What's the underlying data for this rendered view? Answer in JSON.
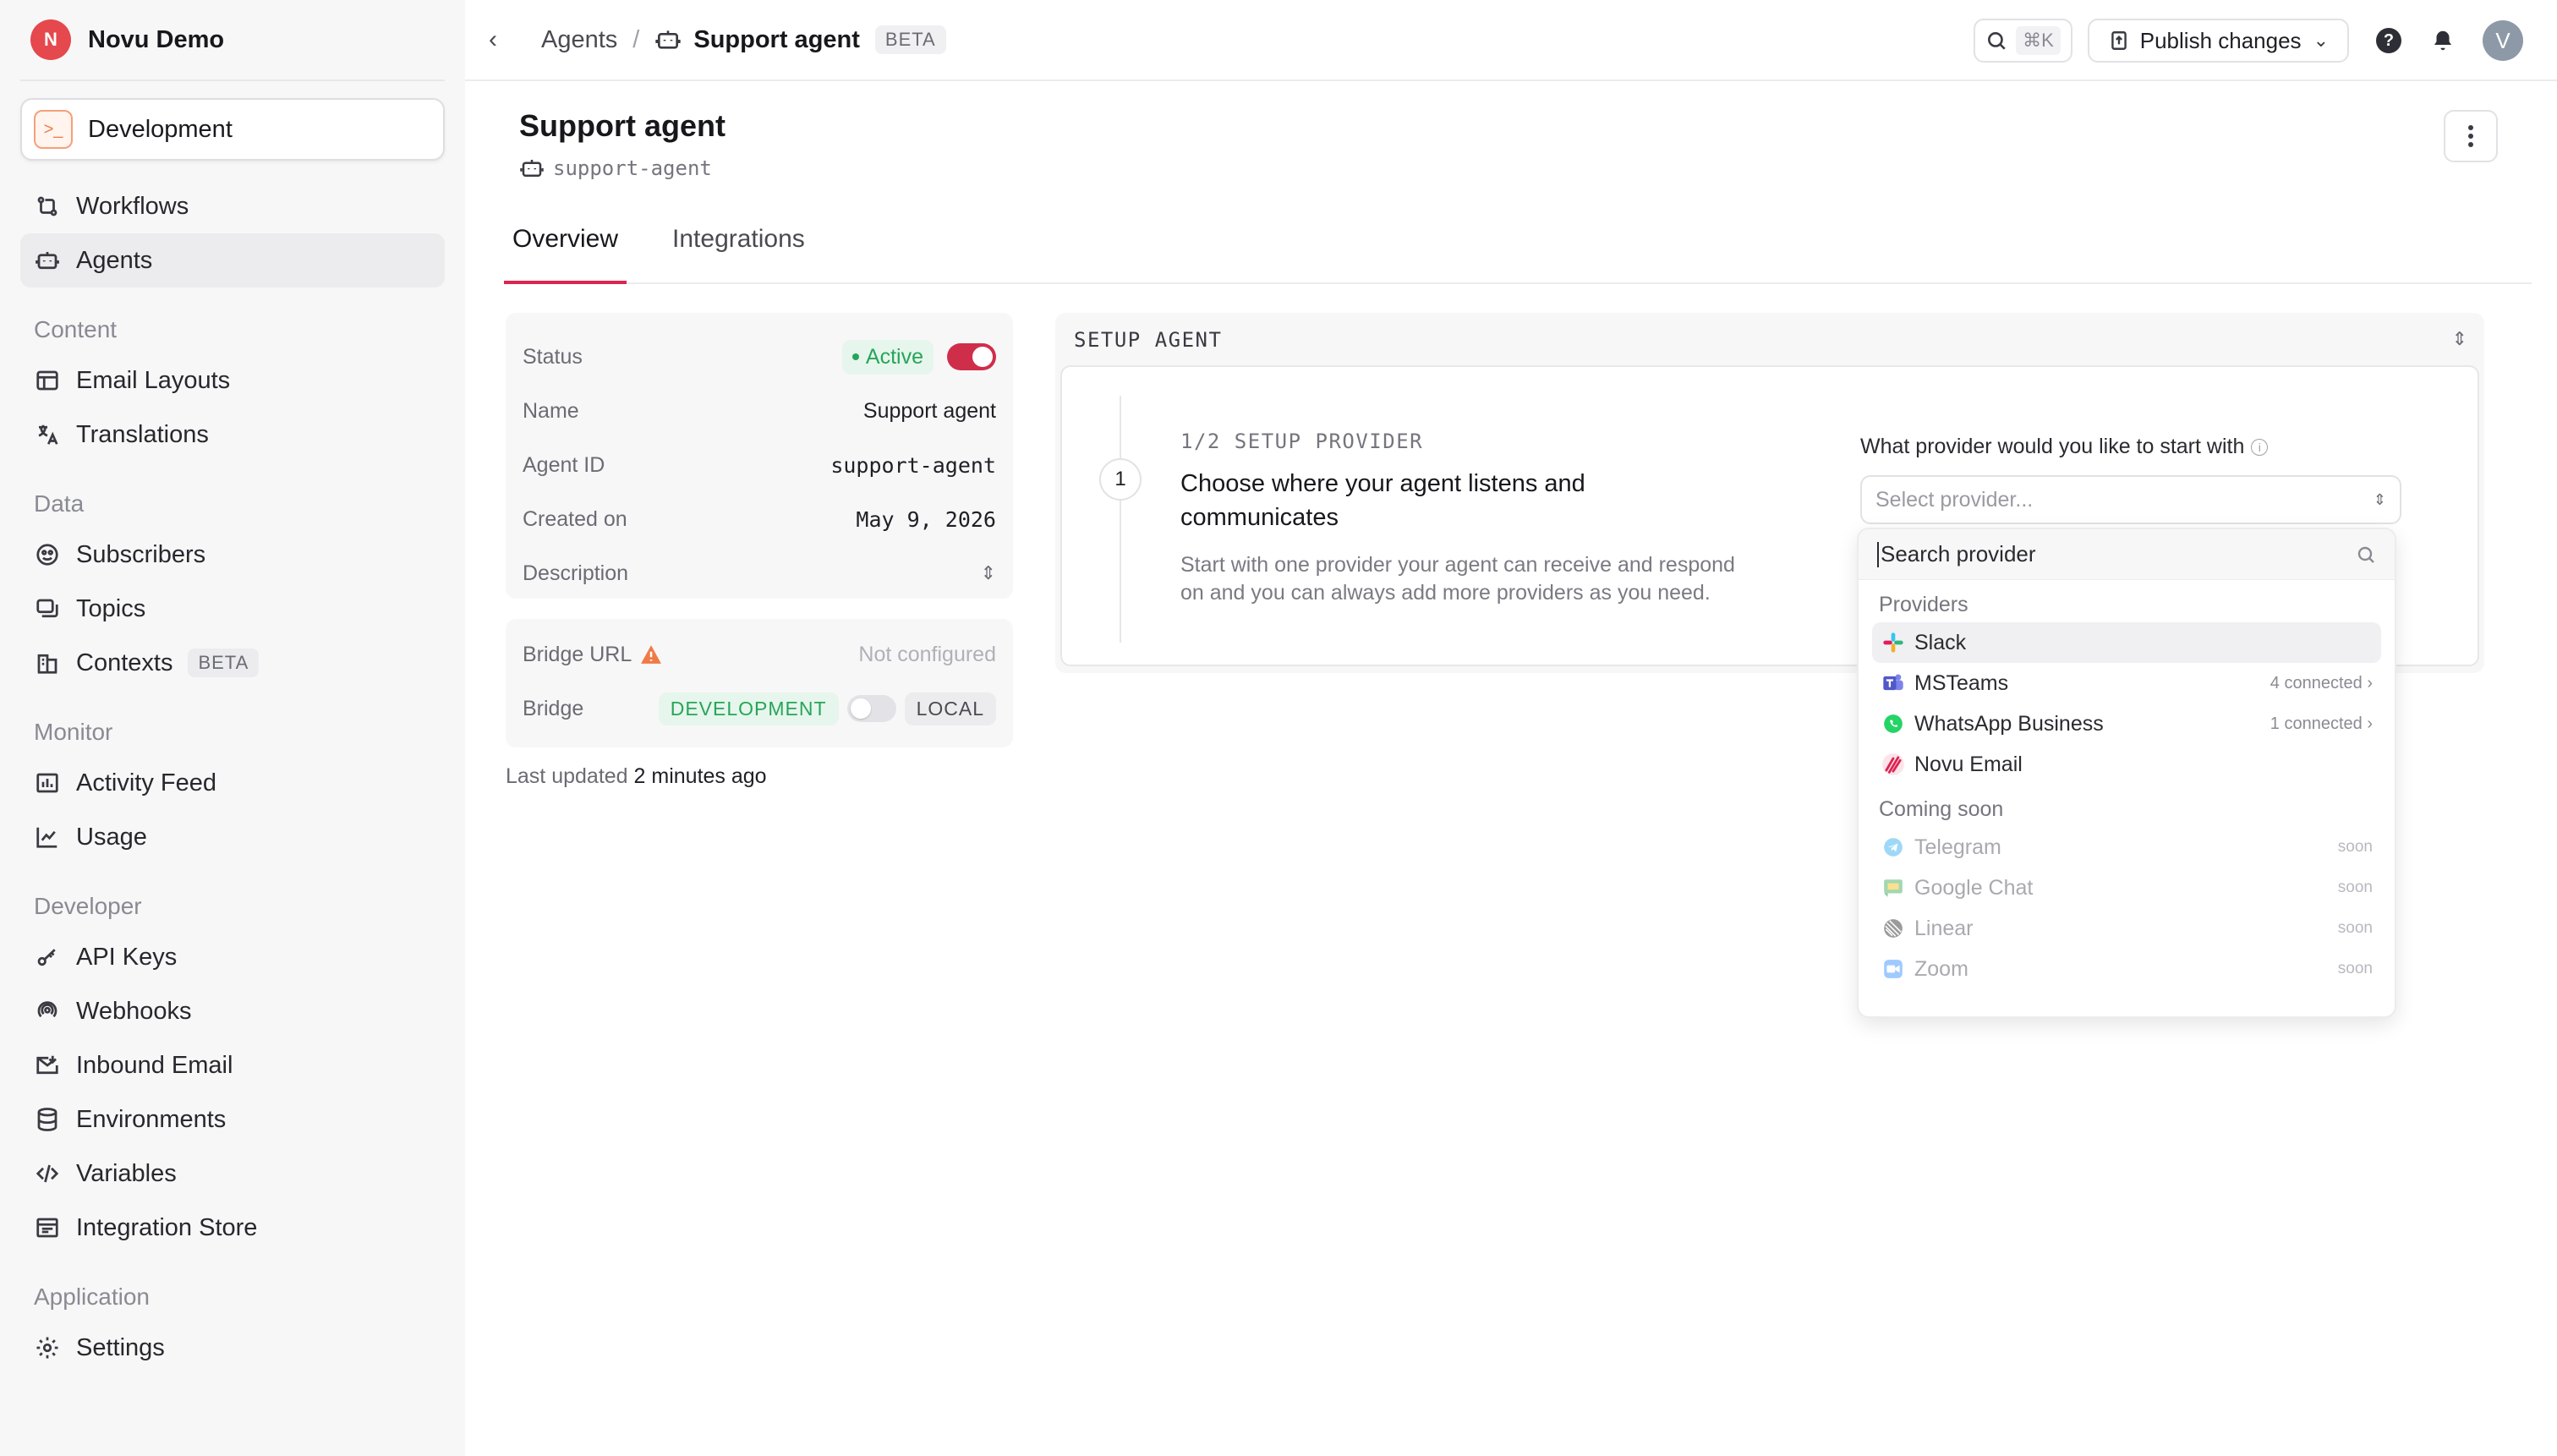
{
  "org": {
    "initial": "N",
    "name": "Novu Demo"
  },
  "environment": {
    "label": "Development"
  },
  "nav": {
    "main": [
      {
        "label": "Workflows"
      },
      {
        "label": "Agents"
      }
    ],
    "content_title": "Content",
    "content": [
      {
        "label": "Email Layouts"
      },
      {
        "label": "Translations"
      }
    ],
    "data_title": "Data",
    "data": [
      {
        "label": "Subscribers"
      },
      {
        "label": "Topics"
      },
      {
        "label": "Contexts",
        "badge": "BETA"
      }
    ],
    "monitor_title": "Monitor",
    "monitor": [
      {
        "label": "Activity Feed"
      },
      {
        "label": "Usage"
      }
    ],
    "developer_title": "Developer",
    "developer": [
      {
        "label": "API Keys"
      },
      {
        "label": "Webhooks"
      },
      {
        "label": "Inbound Email"
      },
      {
        "label": "Environments"
      },
      {
        "label": "Variables"
      },
      {
        "label": "Integration Store"
      }
    ],
    "application_title": "Application",
    "application": [
      {
        "label": "Settings"
      }
    ]
  },
  "topbar": {
    "crumb_parent": "Agents",
    "crumb_sep": "/",
    "crumb_current": "Support agent",
    "crumb_badge": "BETA",
    "search_shortcut": "⌘K",
    "publish_label": "Publish changes",
    "user_initial": "V"
  },
  "page": {
    "title": "Support agent",
    "slug": "support-agent",
    "tabs": [
      {
        "label": "Overview"
      },
      {
        "label": "Integrations"
      }
    ]
  },
  "details": {
    "status_label": "Status",
    "status_value": "Active",
    "name_label": "Name",
    "name_value": "Support agent",
    "id_label": "Agent ID",
    "id_value": "support-agent",
    "created_label": "Created on",
    "created_value": "May 9, 2026",
    "description_label": "Description",
    "bridge_url_label": "Bridge URL",
    "bridge_url_value": "Not configured",
    "bridge_label": "Bridge",
    "bridge_dev": "DEVELOPMENT",
    "bridge_local": "LOCAL",
    "last_updated_prefix": "Last updated",
    "last_updated_value": "2 minutes ago"
  },
  "setup": {
    "header": "SETUP AGENT",
    "step_number": "1",
    "step_tag": "1/2 SETUP PROVIDER",
    "step_title": "Choose where your agent listens and communicates",
    "step_desc": "Start with one provider your agent can receive and respond on and you can always add more providers as you need.",
    "provider_question": "What provider would you like to start with",
    "select_placeholder": "Select provider..."
  },
  "dropdown": {
    "search_placeholder": "Search provider",
    "providers_title": "Providers",
    "providers": [
      {
        "label": "Slack",
        "meta": ""
      },
      {
        "label": "MSTeams",
        "meta": "4 connected"
      },
      {
        "label": "WhatsApp Business",
        "meta": "1 connected"
      },
      {
        "label": "Novu Email",
        "meta": ""
      }
    ],
    "soon_title": "Coming soon",
    "soon": [
      {
        "label": "Telegram",
        "meta": "soon"
      },
      {
        "label": "Google Chat",
        "meta": "soon"
      },
      {
        "label": "Linear",
        "meta": "soon"
      },
      {
        "label": "Zoom",
        "meta": "soon"
      }
    ]
  },
  "colors": {
    "accent": "#dd2450",
    "active_green": "#27a55a",
    "toggle_on": "#cf2e4a",
    "warning": "#f07a45"
  }
}
